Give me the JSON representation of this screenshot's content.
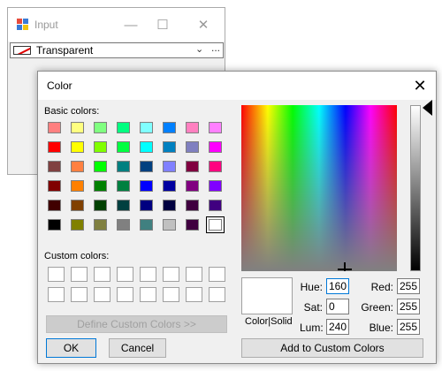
{
  "input_window": {
    "title": "Input",
    "minimize_glyph": "—",
    "maximize_glyph": "☐",
    "close_glyph": "✕",
    "combo": {
      "value": "Transparent",
      "arrow": "⌄",
      "ellipsis": "..."
    }
  },
  "dialog": {
    "title": "Color",
    "close_glyph": "✕",
    "basic_colors_label": "Basic colors:",
    "custom_colors_label": "Custom colors:",
    "basic_colors": [
      [
        "#ff8080",
        "#ffff80",
        "#80ff80",
        "#00ff80",
        "#80ffff",
        "#0080ff",
        "#ff80c0",
        "#ff80ff"
      ],
      [
        "#ff0000",
        "#ffff00",
        "#80ff00",
        "#00ff40",
        "#00ffff",
        "#0080c0",
        "#8080c0",
        "#ff00ff"
      ],
      [
        "#804040",
        "#ff8040",
        "#00ff00",
        "#008080",
        "#004080",
        "#8080ff",
        "#800040",
        "#ff0080"
      ],
      [
        "#800000",
        "#ff8000",
        "#008000",
        "#008040",
        "#0000ff",
        "#0000a0",
        "#800080",
        "#8000ff"
      ],
      [
        "#400000",
        "#804000",
        "#004000",
        "#004040",
        "#000080",
        "#000040",
        "#400040",
        "#400080"
      ],
      [
        "#000000",
        "#808000",
        "#808040",
        "#808080",
        "#408080",
        "#c0c0c0",
        "#400040",
        "#ffffff"
      ]
    ],
    "selected_basic_color": "#ffffff",
    "custom_colors": [
      [
        "#ffffff",
        "#ffffff",
        "#ffffff",
        "#ffffff",
        "#ffffff",
        "#ffffff",
        "#ffffff",
        "#ffffff"
      ],
      [
        "#ffffff",
        "#ffffff",
        "#ffffff",
        "#ffffff",
        "#ffffff",
        "#ffffff",
        "#ffffff",
        "#ffffff"
      ]
    ],
    "define_custom_label": "Define Custom Colors >>",
    "ok_label": "OK",
    "cancel_label": "Cancel",
    "color_solid_label": "Color|Solid",
    "hue_label": "Hue:",
    "sat_label": "Sat:",
    "lum_label": "Lum:",
    "red_label": "Red:",
    "green_label": "Green:",
    "blue_label": "Blue:",
    "hue": "160",
    "sat": "0",
    "lum": "240",
    "red": "255",
    "green": "255",
    "blue": "255",
    "add_custom_label": "Add to Custom Colors",
    "preview_color": "#ffffff"
  }
}
